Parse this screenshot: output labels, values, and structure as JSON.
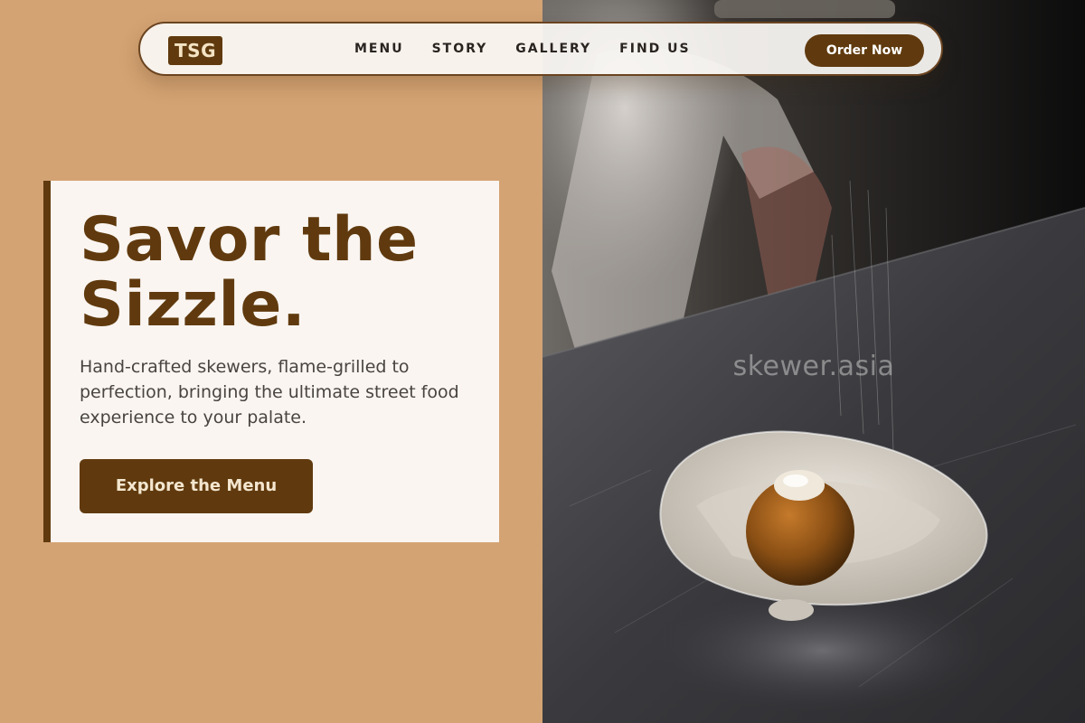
{
  "nav": {
    "logo": "TSG",
    "links": [
      "MENU",
      "STORY",
      "GALLERY",
      "FIND US"
    ],
    "cta_label": "Order Now"
  },
  "hero": {
    "title": "Savor the\nSizzle.",
    "subtitle": "Hand-crafted skewers, flame-grilled to perfection, bringing the ultimate street food experience to your palate.",
    "button_label": "Explore the Menu"
  },
  "photo": {
    "watermark": "skewer.asia"
  },
  "colors": {
    "background_tan": "#d4a373",
    "brand_brown": "#603a0e",
    "card_cream": "#faf5f1"
  }
}
